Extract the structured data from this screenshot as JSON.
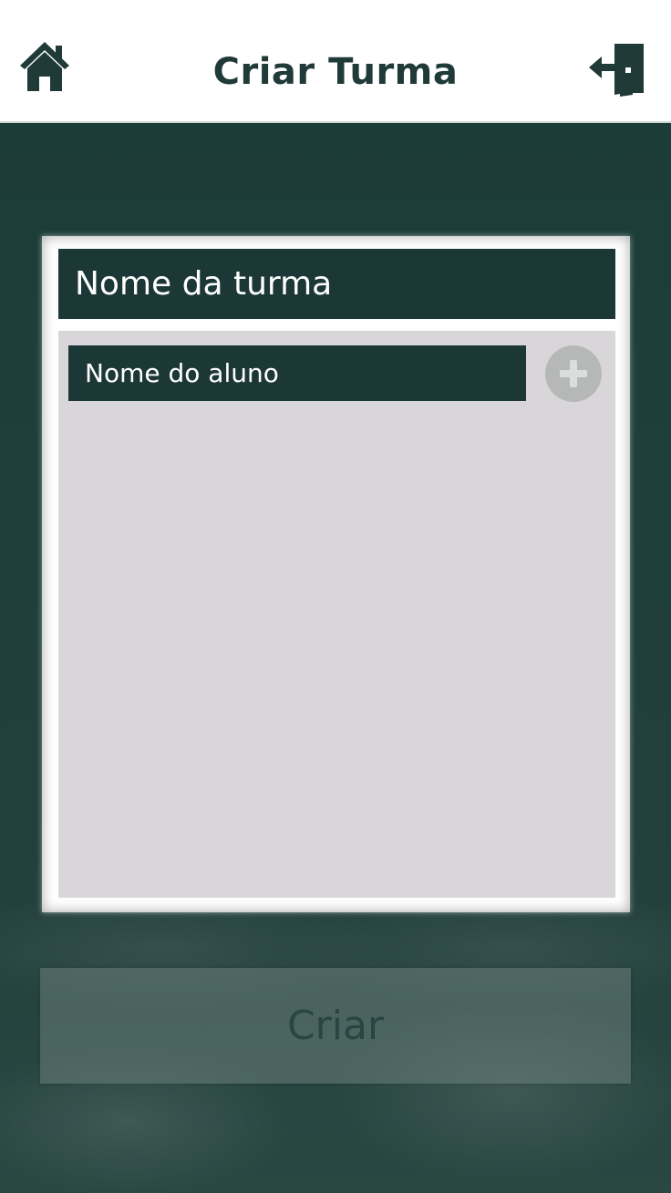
{
  "header": {
    "title": "Criar Turma",
    "home_icon": "home-icon",
    "exit_icon": "exit-door-icon"
  },
  "form": {
    "class_name_placeholder": "Nome da turma",
    "student_name_placeholder": "Nome do aluno",
    "add_icon": "plus-icon"
  },
  "actions": {
    "create_label": "Criar"
  },
  "colors": {
    "primary_dark": "#1c3836",
    "header_bg": "#ffffff",
    "panel_bg": "#d8d6d8",
    "add_button": "#b6b8b8"
  }
}
